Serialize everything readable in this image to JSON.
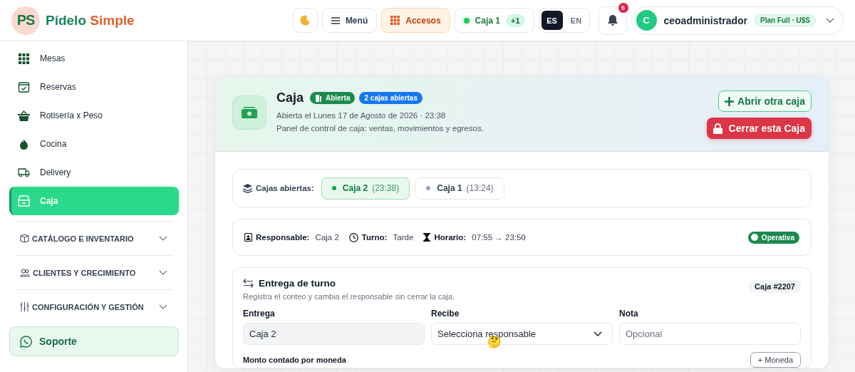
{
  "brand": {
    "logo": "PS",
    "name_first": "Pídelo",
    "name_second": "Simple"
  },
  "topbar": {
    "menu": "Menú",
    "accesos": "Accesos",
    "caja": {
      "label": "Caja 1",
      "count": "+1"
    },
    "languages": [
      {
        "label": "ES",
        "selected": true
      },
      {
        "label": "EN",
        "selected": false
      }
    ],
    "notifications": "5",
    "user": {
      "initial": "C",
      "name": "ceoadministrador",
      "plan": "Plan Full · U$S"
    }
  },
  "sidebar": {
    "items": [
      {
        "label": "Mesas",
        "kind": "grid",
        "selected": false
      },
      {
        "label": "Reservas",
        "kind": "calendar",
        "selected": false
      },
      {
        "label": "Rotisería x Peso",
        "kind": "basket",
        "selected": false
      },
      {
        "label": "Cocina",
        "kind": "flame",
        "selected": false
      },
      {
        "label": "Delivery",
        "kind": "truck",
        "selected": false
      },
      {
        "label": "Caja",
        "kind": "register",
        "selected": true
      }
    ],
    "sections": [
      {
        "label": "CATÁLOGO E INVENTARIO",
        "kind": "box",
        "expanded": false
      },
      {
        "label": "CLIENTES Y CRECIMIENTO",
        "kind": "people",
        "expanded": false
      },
      {
        "label": "CONFIGURACIÓN Y GESTIÓN",
        "kind": "sliders",
        "expanded": false
      }
    ],
    "support": "Soporte"
  },
  "page": {
    "title": "Caja",
    "badges": [
      {
        "label": "Abierta",
        "kind": "status"
      },
      {
        "label": "2 cajas abiertas",
        "kind": "count"
      }
    ],
    "opened": "Abierta el Lunes 17 de Agosto de 2026 · 23:38",
    "subtitle": "Panel de control de caja: ventas, movimientos y egresos.",
    "open_button": "Abrir otra caja",
    "close_button": "Cerrar esta Caja"
  },
  "open_boxes": {
    "label": "Cajas abiertas:",
    "items": [
      {
        "name": "Caja 2",
        "time": "(23:38)",
        "selected": true
      },
      {
        "name": "Caja 1",
        "time": "(13:24)",
        "selected": false
      }
    ]
  },
  "info": {
    "items": [
      {
        "kind": "person",
        "label": "Responsable:",
        "value": "Caja 2"
      },
      {
        "kind": "clock",
        "label": "Turno:",
        "value": "Tarde"
      },
      {
        "kind": "hourglass",
        "label": "Horario:",
        "value": "07:55 → 23:50"
      }
    ],
    "status": "Operativa"
  },
  "handover": {
    "title": "Entrega de turno",
    "subtitle": "Registra el conteo y cambia el responsable sin cerrar la caja.",
    "tag": "Caja #2207",
    "fields": [
      {
        "label": "Entrega",
        "kind": "readonly",
        "value": "Caja 2"
      },
      {
        "label": "Recibe",
        "kind": "select",
        "value": "Selecciona responsable",
        "emoji": "🤔"
      },
      {
        "label": "Nota",
        "kind": "text",
        "placeholder": "Opcional"
      }
    ],
    "amount_label": "Monto contado por moneda",
    "add_currency": "+ Moneda"
  }
}
